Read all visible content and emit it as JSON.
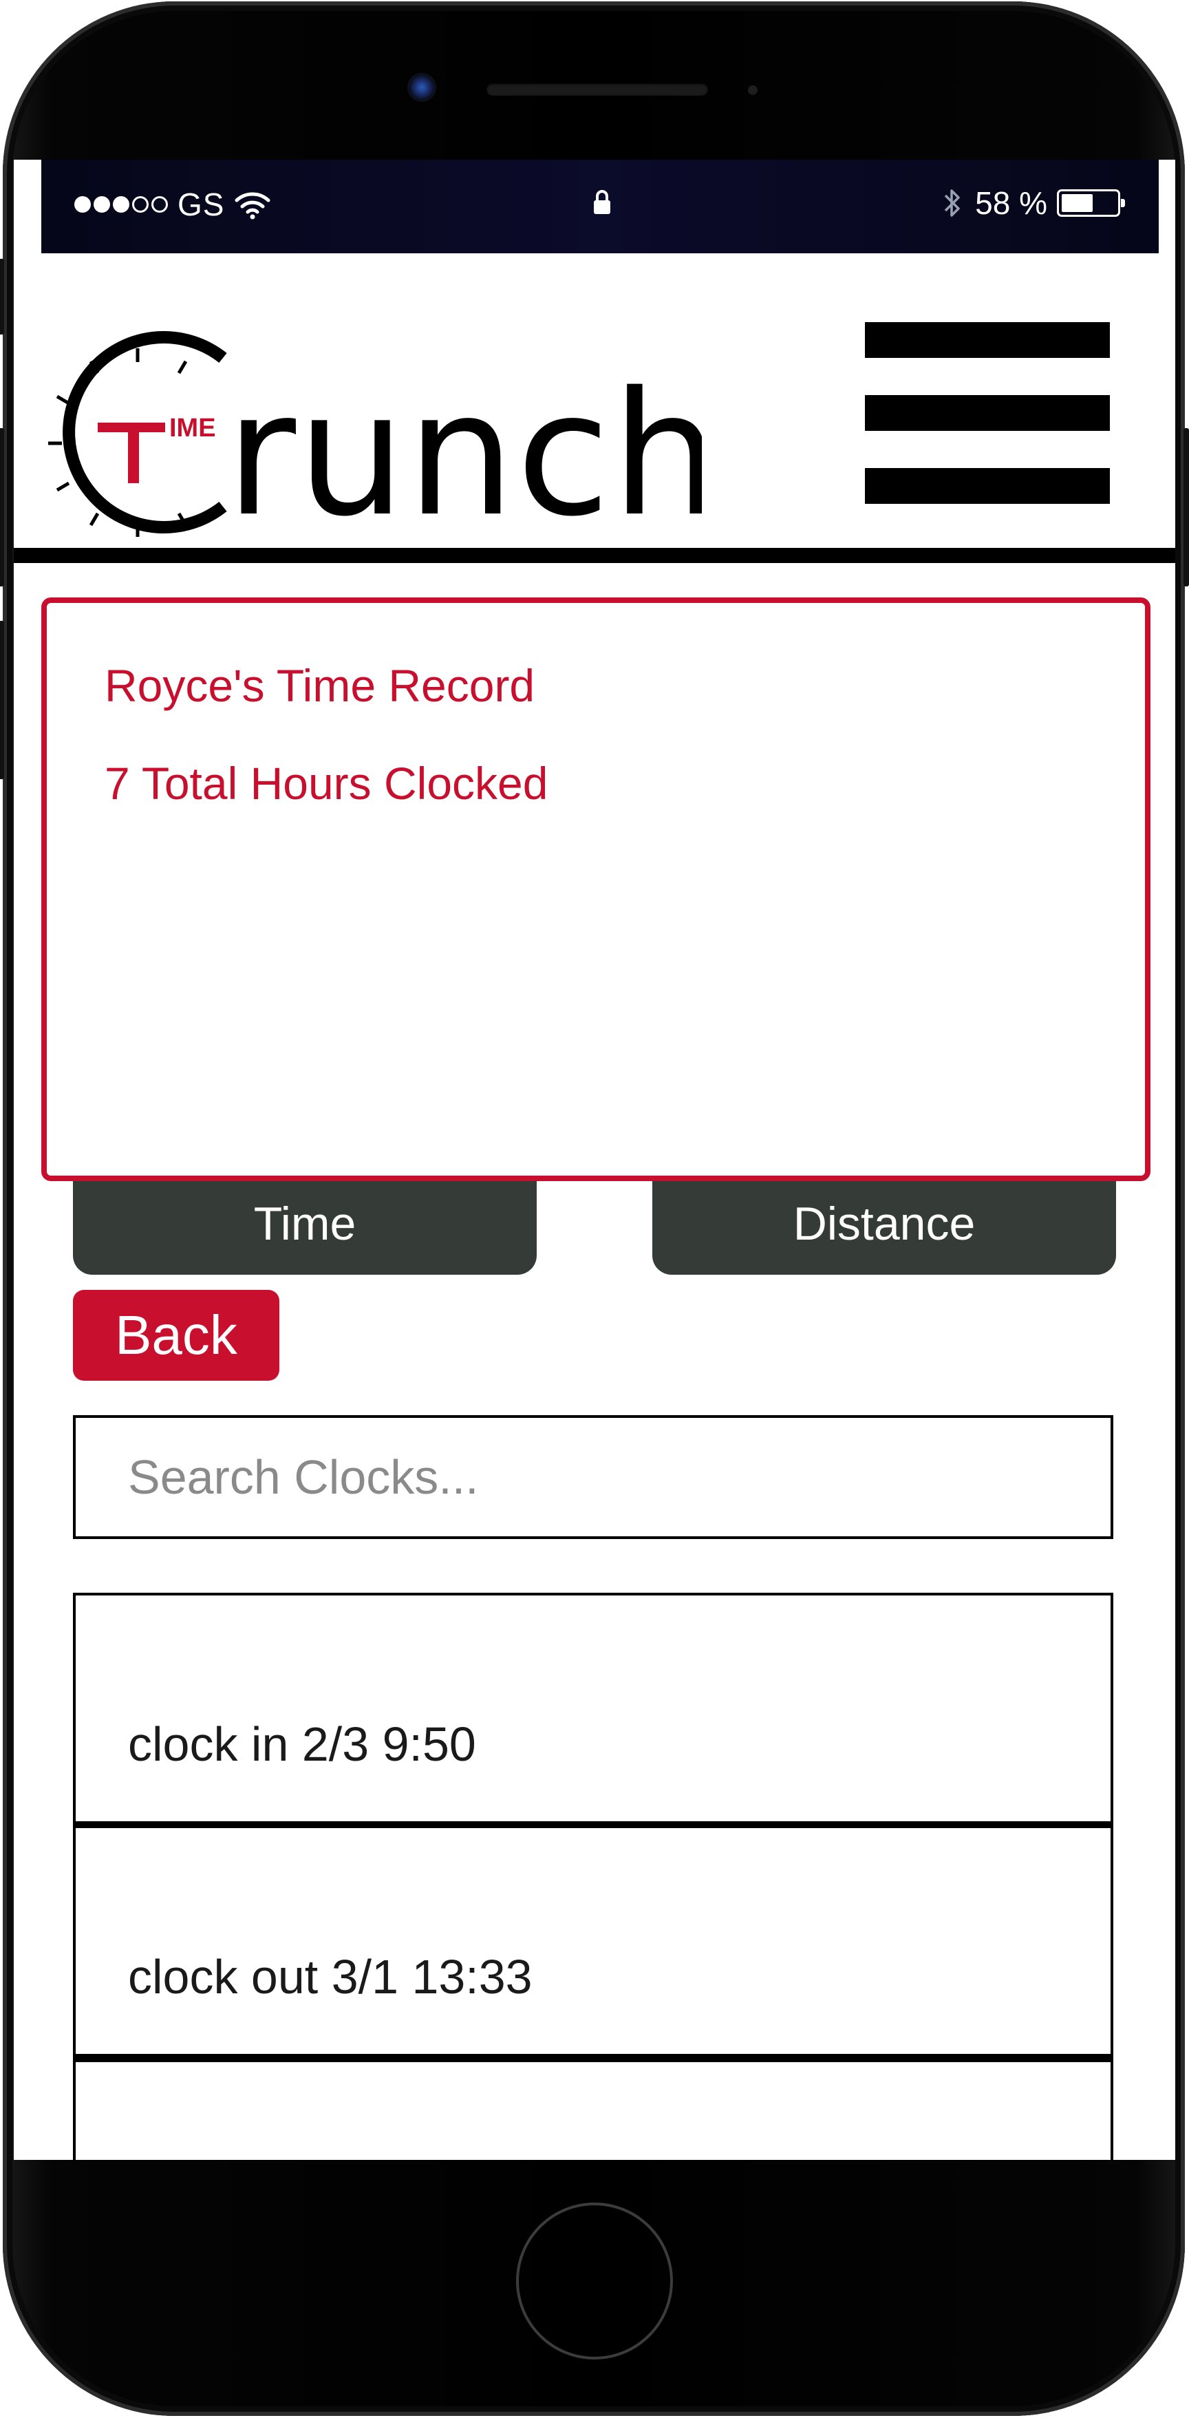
{
  "status_bar": {
    "signal_dots_filled": 3,
    "signal_dots_total": 5,
    "carrier": "GS",
    "battery_percent_label": "58 %",
    "battery_level": 0.58,
    "icons": [
      "wifi-icon",
      "lock-icon",
      "bluetooth-icon",
      "battery-icon"
    ]
  },
  "header": {
    "logo_text": "Crunch",
    "logo_badge_text": "IME",
    "menu_icon": "hamburger-menu-icon"
  },
  "record": {
    "title": "Royce's Time Record",
    "total_hours": "7 Total Hours Clocked"
  },
  "tabs": [
    {
      "label": "Time"
    },
    {
      "label": "Distance"
    }
  ],
  "back_label": "Back",
  "search": {
    "placeholder": "Search Clocks...",
    "value": ""
  },
  "clocks": [
    {
      "label": "clock in 2/3 9:50"
    },
    {
      "label": "clock out 3/1 13:33"
    },
    {
      "label": ""
    }
  ],
  "colors": {
    "accent": "#c8102e",
    "tab_background": "#353c38",
    "status_bar": "#0b0b2a"
  }
}
